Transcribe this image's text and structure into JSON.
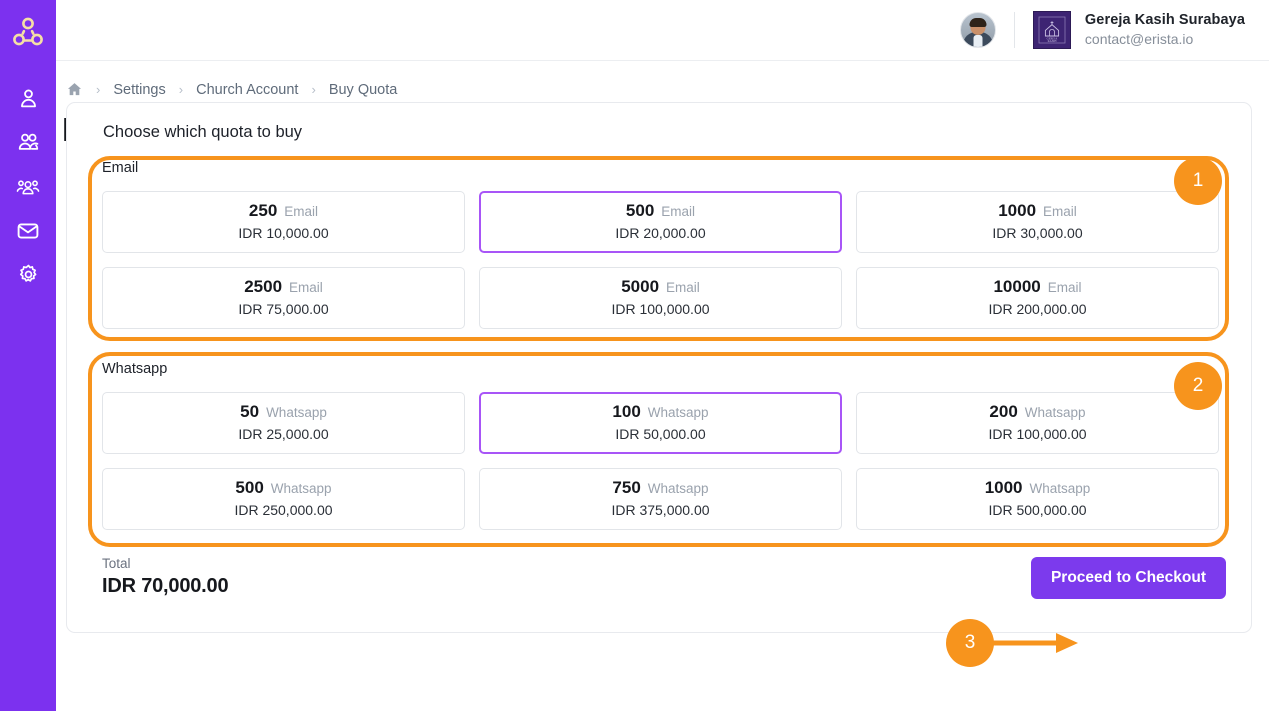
{
  "brand": {
    "accent_purple": "#7c31ef",
    "accent_orange": "#f7941d",
    "selected_border": "#a855f7",
    "logo_icon": "triad-circles-logo"
  },
  "sidebar": {
    "items": [
      {
        "icon": "user-icon",
        "name": "sidebar-item-user"
      },
      {
        "icon": "users-pair-icon",
        "name": "sidebar-item-members"
      },
      {
        "icon": "user-group-icon",
        "name": "sidebar-item-groups"
      },
      {
        "icon": "envelope-icon",
        "name": "sidebar-item-mail"
      },
      {
        "icon": "gear-icon",
        "name": "sidebar-item-settings"
      }
    ]
  },
  "topbar": {
    "avatar_alt": "user-avatar",
    "org_logo_alt": "gereja-kasih-logo",
    "org_name": "Gereja Kasih Surabaya",
    "org_email": "contact@erista.io"
  },
  "breadcrumb": {
    "home_icon": "home-icon",
    "separator": "›",
    "items": [
      "Settings",
      "Church Account",
      "Buy Quota"
    ]
  },
  "page": {
    "title": "Buy Quota",
    "panel_heading": "Choose which quota to buy"
  },
  "groups": [
    {
      "label": "Email",
      "badge": "1",
      "cards": [
        {
          "amount": "250",
          "unit": "Email",
          "price": "IDR 10,000.00",
          "selected": false
        },
        {
          "amount": "500",
          "unit": "Email",
          "price": "IDR 20,000.00",
          "selected": true
        },
        {
          "amount": "1000",
          "unit": "Email",
          "price": "IDR 30,000.00",
          "selected": false
        },
        {
          "amount": "2500",
          "unit": "Email",
          "price": "IDR 75,000.00",
          "selected": false
        },
        {
          "amount": "5000",
          "unit": "Email",
          "price": "IDR 100,000.00",
          "selected": false
        },
        {
          "amount": "10000",
          "unit": "Email",
          "price": "IDR 200,000.00",
          "selected": false
        }
      ]
    },
    {
      "label": "Whatsapp",
      "badge": "2",
      "cards": [
        {
          "amount": "50",
          "unit": "Whatsapp",
          "price": "IDR 25,000.00",
          "selected": false
        },
        {
          "amount": "100",
          "unit": "Whatsapp",
          "price": "IDR 50,000.00",
          "selected": true
        },
        {
          "amount": "200",
          "unit": "Whatsapp",
          "price": "IDR 100,000.00",
          "selected": false
        },
        {
          "amount": "500",
          "unit": "Whatsapp",
          "price": "IDR 250,000.00",
          "selected": false
        },
        {
          "amount": "750",
          "unit": "Whatsapp",
          "price": "IDR 375,000.00",
          "selected": false
        },
        {
          "amount": "1000",
          "unit": "Whatsapp",
          "price": "IDR 500,000.00",
          "selected": false
        }
      ]
    }
  ],
  "footer": {
    "total_label": "Total",
    "total_value": "IDR 70,000.00",
    "checkout_label": "Proceed to Checkout",
    "checkout_badge": "3"
  }
}
